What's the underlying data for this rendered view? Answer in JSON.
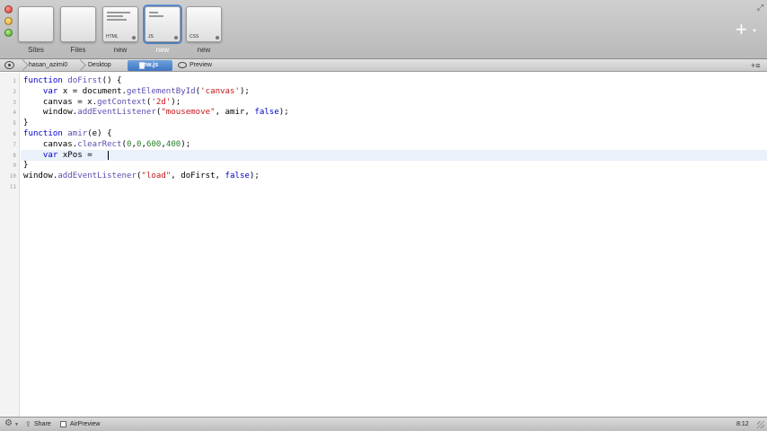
{
  "window": {
    "traffic_lights": [
      "close",
      "minimize",
      "maximize"
    ]
  },
  "tabs": [
    {
      "label": "Sites",
      "tag": "",
      "active": false
    },
    {
      "label": "Files",
      "tag": "",
      "active": false
    },
    {
      "label": "new",
      "tag": "HTML",
      "active": false
    },
    {
      "label": "new",
      "tag": "JS",
      "active": true
    },
    {
      "label": "new",
      "tag": "CSS",
      "active": false
    }
  ],
  "toolbar": {
    "add_icon": "plus-icon",
    "fullscreen_icon": "fullscreen-icon"
  },
  "pathbar": {
    "crumbs": [
      "hasan_azimi0",
      "Desktop"
    ],
    "file": "new.js",
    "preview": "Preview"
  },
  "editor": {
    "language": "JavaScript",
    "current_line": 8,
    "lines": [
      [
        {
          "t": "kw",
          "v": "function "
        },
        {
          "t": "fn",
          "v": "doFirst"
        },
        {
          "t": "",
          "v": "() {"
        }
      ],
      [
        {
          "t": "",
          "v": "    "
        },
        {
          "t": "kw",
          "v": "var"
        },
        {
          "t": "",
          "v": " x = document."
        },
        {
          "t": "fn",
          "v": "getElementById"
        },
        {
          "t": "",
          "v": "("
        },
        {
          "t": "str",
          "v": "'canvas'"
        },
        {
          "t": "",
          "v": ");"
        }
      ],
      [
        {
          "t": "",
          "v": "    canvas = x."
        },
        {
          "t": "fn",
          "v": "getContext"
        },
        {
          "t": "",
          "v": "("
        },
        {
          "t": "str",
          "v": "'2d'"
        },
        {
          "t": "",
          "v": ");"
        }
      ],
      [
        {
          "t": "",
          "v": "    window."
        },
        {
          "t": "fn",
          "v": "addEventListener"
        },
        {
          "t": "",
          "v": "("
        },
        {
          "t": "str",
          "v": "\"mousemove\""
        },
        {
          "t": "",
          "v": ", amir, "
        },
        {
          "t": "kw",
          "v": "false"
        },
        {
          "t": "",
          "v": ");"
        }
      ],
      [
        {
          "t": "",
          "v": "}"
        }
      ],
      [
        {
          "t": "kw",
          "v": "function "
        },
        {
          "t": "fn",
          "v": "amir"
        },
        {
          "t": "",
          "v": "(e) {"
        }
      ],
      [
        {
          "t": "",
          "v": "    canvas."
        },
        {
          "t": "fn",
          "v": "clearRect"
        },
        {
          "t": "",
          "v": "("
        },
        {
          "t": "num",
          "v": "0"
        },
        {
          "t": "",
          "v": ","
        },
        {
          "t": "num",
          "v": "0"
        },
        {
          "t": "",
          "v": ","
        },
        {
          "t": "num",
          "v": "600"
        },
        {
          "t": "",
          "v": ","
        },
        {
          "t": "num",
          "v": "400"
        },
        {
          "t": "",
          "v": ");"
        }
      ],
      [
        {
          "t": "",
          "v": "    "
        },
        {
          "t": "kw",
          "v": "var"
        },
        {
          "t": "",
          "v": " xPos = "
        }
      ],
      [
        {
          "t": "",
          "v": "}"
        }
      ],
      [
        {
          "t": "",
          "v": "window."
        },
        {
          "t": "fn",
          "v": "addEventListener"
        },
        {
          "t": "",
          "v": "("
        },
        {
          "t": "str",
          "v": "\"load\""
        },
        {
          "t": "",
          "v": ", doFirst, "
        },
        {
          "t": "kw",
          "v": "false"
        },
        {
          "t": "",
          "v": ");"
        }
      ],
      [
        {
          "t": "",
          "v": ""
        }
      ]
    ]
  },
  "statusbar": {
    "share_label": "Share",
    "airpreview_label": "AirPreview",
    "cursor_position": "8:12"
  },
  "colors": {
    "keyword": "#0000c8",
    "function": "#5a4fb0",
    "string": "#c2171c",
    "number": "#2a7d2a",
    "active_tab": "#5a8fd0"
  }
}
